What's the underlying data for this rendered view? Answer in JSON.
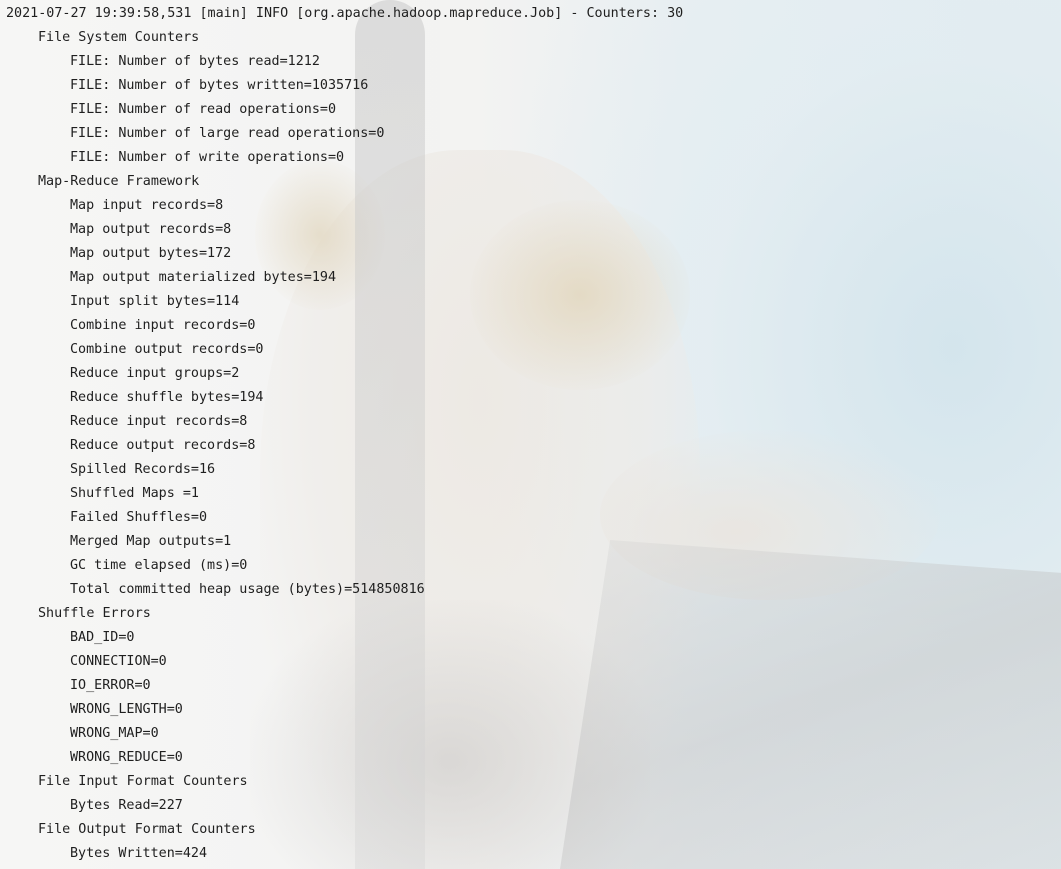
{
  "console": {
    "header": "2021-07-27 19:39:58,531 [main] INFO [org.apache.hadoop.mapreduce.Job] - Counters: 30",
    "groups": [
      {
        "name": "File System Counters",
        "counters": [
          "FILE: Number of bytes read=1212",
          "FILE: Number of bytes written=1035716",
          "FILE: Number of read operations=0",
          "FILE: Number of large read operations=0",
          "FILE: Number of write operations=0"
        ]
      },
      {
        "name": "Map-Reduce Framework",
        "counters": [
          "Map input records=8",
          "Map output records=8",
          "Map output bytes=172",
          "Map output materialized bytes=194",
          "Input split bytes=114",
          "Combine input records=0",
          "Combine output records=0",
          "Reduce input groups=2",
          "Reduce shuffle bytes=194",
          "Reduce input records=8",
          "Reduce output records=8",
          "Spilled Records=16",
          "Shuffled Maps =1",
          "Failed Shuffles=0",
          "Merged Map outputs=1",
          "GC time elapsed (ms)=0",
          "Total committed heap usage (bytes)=514850816"
        ]
      },
      {
        "name": "Shuffle Errors",
        "counters": [
          "BAD_ID=0",
          "CONNECTION=0",
          "IO_ERROR=0",
          "WRONG_LENGTH=0",
          "WRONG_MAP=0",
          "WRONG_REDUCE=0"
        ]
      },
      {
        "name": "File Input Format Counters",
        "counters": [
          "Bytes Read=227"
        ]
      },
      {
        "name": "File Output Format Counters",
        "counters": [
          "Bytes Written=424"
        ]
      }
    ]
  },
  "colors": {
    "text": "#1f1f1f",
    "background": "#f4f5f6"
  }
}
